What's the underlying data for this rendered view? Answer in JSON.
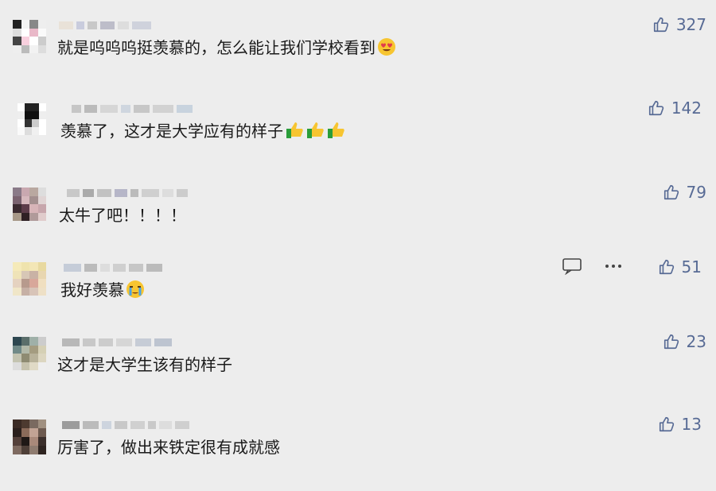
{
  "comments": [
    {
      "text": "就是呜呜呜挺羡慕的，怎么能让我们学校看到",
      "likes": "327",
      "emojis": [
        "heart-eyes"
      ]
    },
    {
      "text": "羡慕了，这才是大学应有的样子",
      "likes": "142",
      "emojis": [
        "thumbs-up",
        "thumbs-up",
        "thumbs-up"
      ]
    },
    {
      "text": "太牛了吧！！！！",
      "likes": "79",
      "emojis": []
    },
    {
      "text": "我好羡慕",
      "likes": "51",
      "emojis": [
        "crying"
      ],
      "tools": true
    },
    {
      "text": "这才是大学生该有的样子",
      "likes": "23",
      "emojis": []
    },
    {
      "text": "厉害了，做出来铁定很有成就感",
      "likes": "13",
      "emojis": []
    }
  ],
  "colors": {
    "background": "#ededed",
    "accent": "#586b95"
  }
}
